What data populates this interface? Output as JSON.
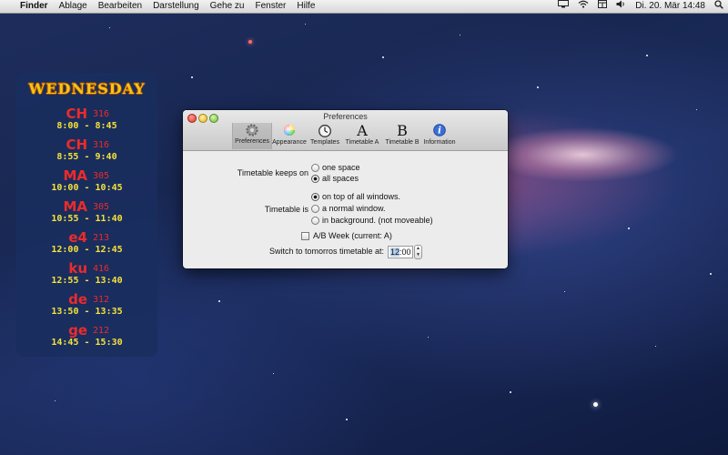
{
  "menubar": {
    "apple_icon": "",
    "app_name": "Finder",
    "items": [
      "Ablage",
      "Bearbeiten",
      "Darstellung",
      "Gehe zu",
      "Fenster",
      "Hilfe"
    ],
    "clock": "Di. 20. Mär  14:48",
    "status_icons": [
      "display-icon",
      "wifi-icon",
      "timetable-icon",
      "volume-icon"
    ]
  },
  "widget": {
    "day": "WEDNESDAY",
    "lessons": [
      {
        "subject": "CH",
        "room": "316",
        "time": "8:00 - 8:45"
      },
      {
        "subject": "CH",
        "room": "316",
        "time": "8:55 - 9:40"
      },
      {
        "subject": "MA",
        "room": "305",
        "time": "10:00 - 10:45"
      },
      {
        "subject": "MA",
        "room": "305",
        "time": "10:55 - 11:40"
      },
      {
        "subject": "e4",
        "room": "213",
        "time": "12:00 - 12:45"
      },
      {
        "subject": "ku",
        "room": "416",
        "time": "12:55 - 13:40"
      },
      {
        "subject": "de",
        "room": "312",
        "time": "13:50 - 13:35"
      },
      {
        "subject": "ge",
        "room": "212",
        "time": "14:45 - 15:30"
      }
    ]
  },
  "window": {
    "title": "Preferences",
    "toolbar": [
      {
        "label": "Preferences",
        "icon": "⚙"
      },
      {
        "label": "Appearance",
        "icon": "●"
      },
      {
        "label": "Templates",
        "icon": "◷"
      },
      {
        "label": "Timetable A",
        "icon": "A"
      },
      {
        "label": "Timetable B",
        "icon": "B"
      },
      {
        "label": "Information",
        "icon": "i"
      }
    ],
    "keeps_on_label": "Timetable keeps on",
    "keeps_on_options": [
      "one space",
      "all spaces"
    ],
    "keeps_on_selected": "all spaces",
    "timetable_is_label": "Timetable is",
    "timetable_is_options": [
      "on top of all windows.",
      "a normal window.",
      "in background. (not moveable)"
    ],
    "timetable_is_selected": "on top of all windows.",
    "ab_week_label": "A/B Week  (current: A)",
    "ab_week_checked": false,
    "switch_label": "Switch to tomorros timetable at:",
    "switch_hours": "12",
    "switch_separator": ":",
    "switch_minutes": "00"
  }
}
